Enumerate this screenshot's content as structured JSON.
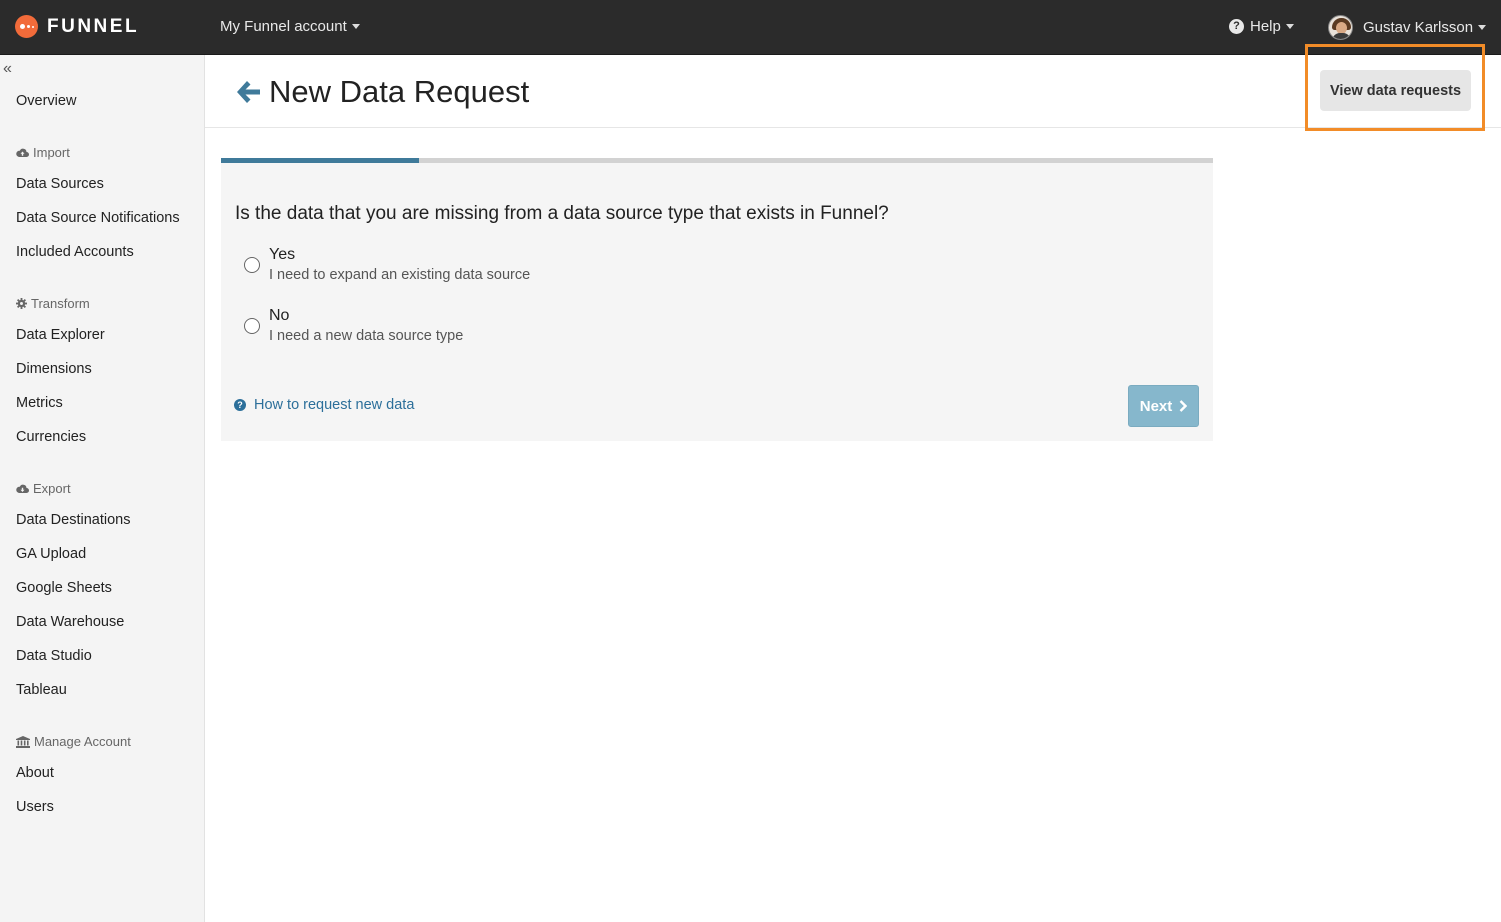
{
  "topbar": {
    "brand": "FUNNEL",
    "account_menu": "My Funnel account",
    "help_menu": "Help",
    "user_name": "Gustav Karlsson"
  },
  "sidebar": {
    "collapse_icon": "double-chevron-left-icon",
    "overview": "Overview",
    "sections": {
      "import": {
        "title": "Import",
        "icon": "cloud-upload-icon",
        "items": [
          "Data Sources",
          "Data Source Notifications",
          "Included Accounts"
        ]
      },
      "transform": {
        "title": "Transform",
        "icon": "gear-icon",
        "items": [
          "Data Explorer",
          "Dimensions",
          "Metrics",
          "Currencies"
        ]
      },
      "export": {
        "title": "Export",
        "icon": "cloud-download-icon",
        "items": [
          "Data Destinations",
          "GA Upload",
          "Google Sheets",
          "Data Warehouse",
          "Data Studio",
          "Tableau"
        ]
      },
      "manage": {
        "title": "Manage Account",
        "icon": "bank-icon",
        "items": [
          "About",
          "Users"
        ]
      }
    }
  },
  "header": {
    "title": "New Data Request",
    "view_requests_button": "View data requests"
  },
  "form": {
    "progress": 0.2,
    "question": "Is the data that you are missing from a data source type that exists in Funnel?",
    "options": [
      {
        "label": "Yes",
        "description": "I need to expand an existing data source",
        "selected": false
      },
      {
        "label": "No",
        "description": "I need a new data source type",
        "selected": false
      }
    ],
    "help_link": "How to request new data",
    "next_button": "Next"
  },
  "colors": {
    "topbar": "#2b2b2b",
    "brand_orange": "#f26b3a",
    "accent_blue": "#2c6f9a",
    "next_button": "#86b7cc",
    "highlight": "#f28c28"
  }
}
